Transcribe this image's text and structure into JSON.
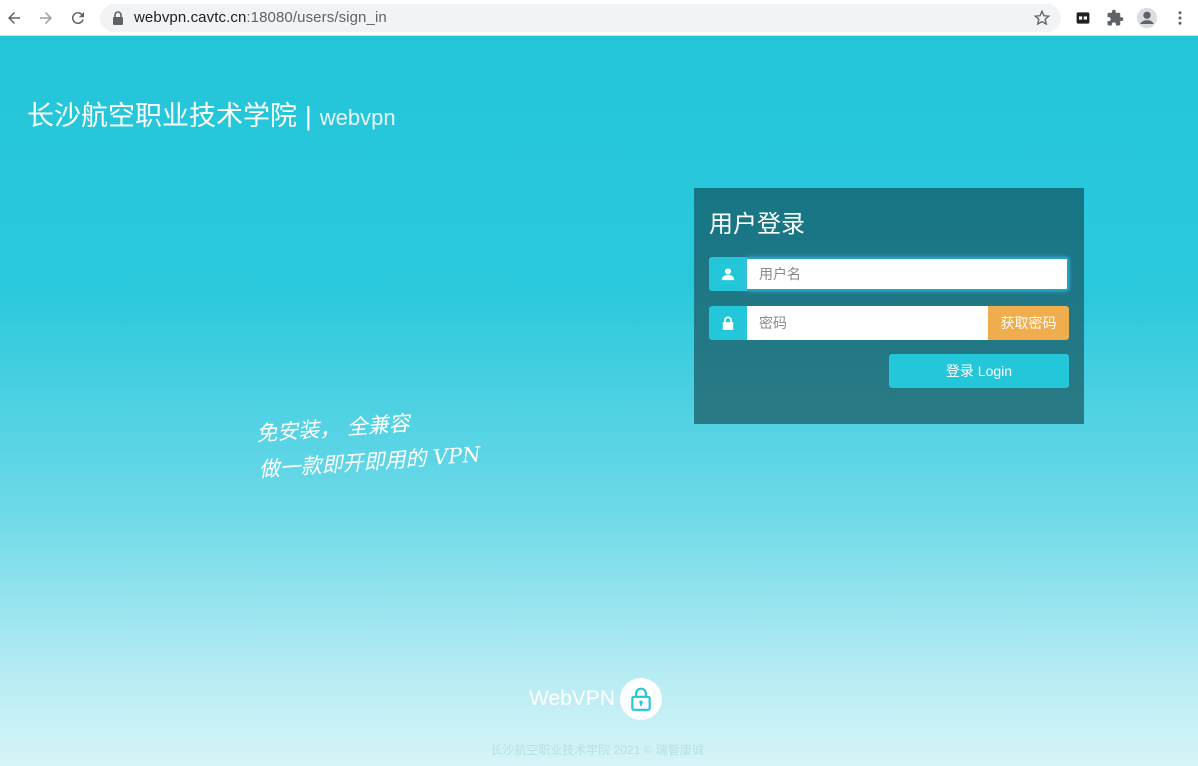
{
  "browser": {
    "url_host": "webvpn.cavtc.cn",
    "url_path": ":18080/users/sign_in",
    "icons": [
      "back-icon",
      "forward-icon",
      "reload-icon",
      "lock-icon",
      "star-icon",
      "extension-icon",
      "puzzle-icon",
      "profile-icon",
      "menu-icon"
    ]
  },
  "header": {
    "school": "长沙航空职业技术学院",
    "separator": "|",
    "product": "webvpn"
  },
  "slogan": {
    "line1": "免安装，  全兼容",
    "line2": "做一款即开即用的 VPN"
  },
  "login": {
    "title": "用户登录",
    "username_placeholder": "用户名",
    "password_placeholder": "密码",
    "get_password_label": "获取密码",
    "login_label": "登录 Login"
  },
  "footer": {
    "logo_text": "WebVPN",
    "copyright": "长沙航空职业技术学院 2021 © 瑞智康诚"
  },
  "colors": {
    "accent": "#24c6da",
    "panel": "#167585",
    "warning": "#f0ad4e"
  }
}
